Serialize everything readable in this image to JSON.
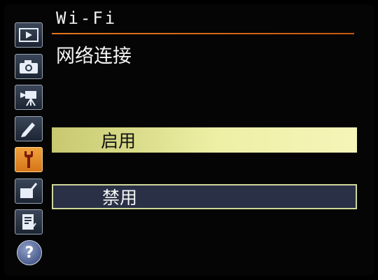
{
  "header": {
    "title": "Wi-Fi",
    "subtitle": "网络连接"
  },
  "sidebar": {
    "items": [
      {
        "icon": "playback-icon",
        "active": false
      },
      {
        "icon": "camera-icon",
        "active": false
      },
      {
        "icon": "movie-icon",
        "active": false
      },
      {
        "icon": "pencil-icon",
        "active": false
      },
      {
        "icon": "wrench-icon",
        "active": true
      },
      {
        "icon": "retouch-icon",
        "active": false
      },
      {
        "icon": "my-menu-icon",
        "active": false
      }
    ],
    "help_label": "?"
  },
  "options": [
    {
      "label": "启用",
      "selected": true
    },
    {
      "label": "禁用",
      "selected": false
    }
  ],
  "colors": {
    "accent_rule": "#e3741c",
    "active_tab": "#e88a2a",
    "selected_bg": "#eef0a6",
    "option_bg": "#2a3147"
  }
}
